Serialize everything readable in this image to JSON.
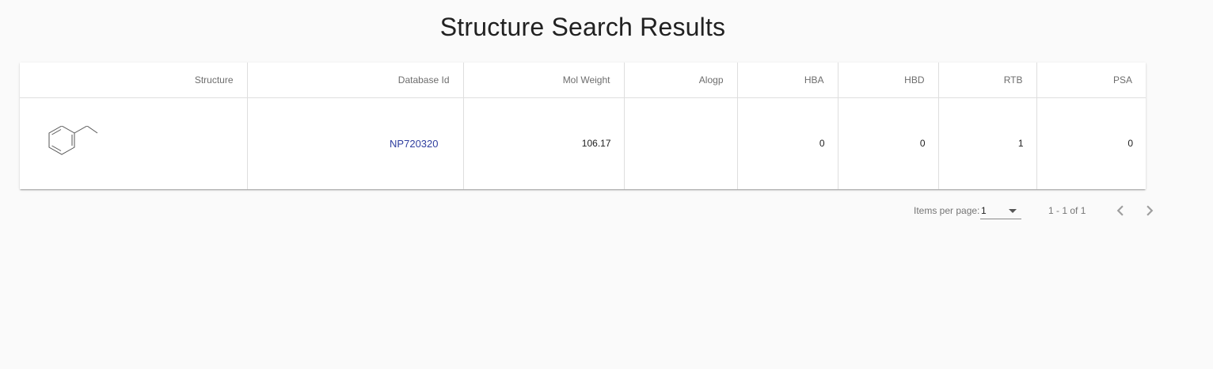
{
  "page": {
    "title": "Structure Search Results"
  },
  "table": {
    "columns": [
      "Structure",
      "Database Id",
      "Mol Weight",
      "Alogp",
      "HBA",
      "HBD",
      "RTB",
      "PSA"
    ],
    "rows": [
      {
        "structure_icon": "ethylbenzene-structure-icon",
        "database_id": "NP720320",
        "mol_weight": "106.17",
        "alogp": "",
        "hba": "0",
        "hbd": "0",
        "rtb": "1",
        "psa": "0"
      }
    ]
  },
  "paginator": {
    "items_per_page_label": "Items per page:",
    "items_per_page_value": "1",
    "range_label": "1 - 1 of 1",
    "prev_icon": "chevron-left-icon",
    "next_icon": "chevron-right-icon"
  },
  "colors": {
    "link": "#303f9f",
    "header_text": "#6d6d6d",
    "border": "#dedede",
    "background": "#fafafa"
  }
}
